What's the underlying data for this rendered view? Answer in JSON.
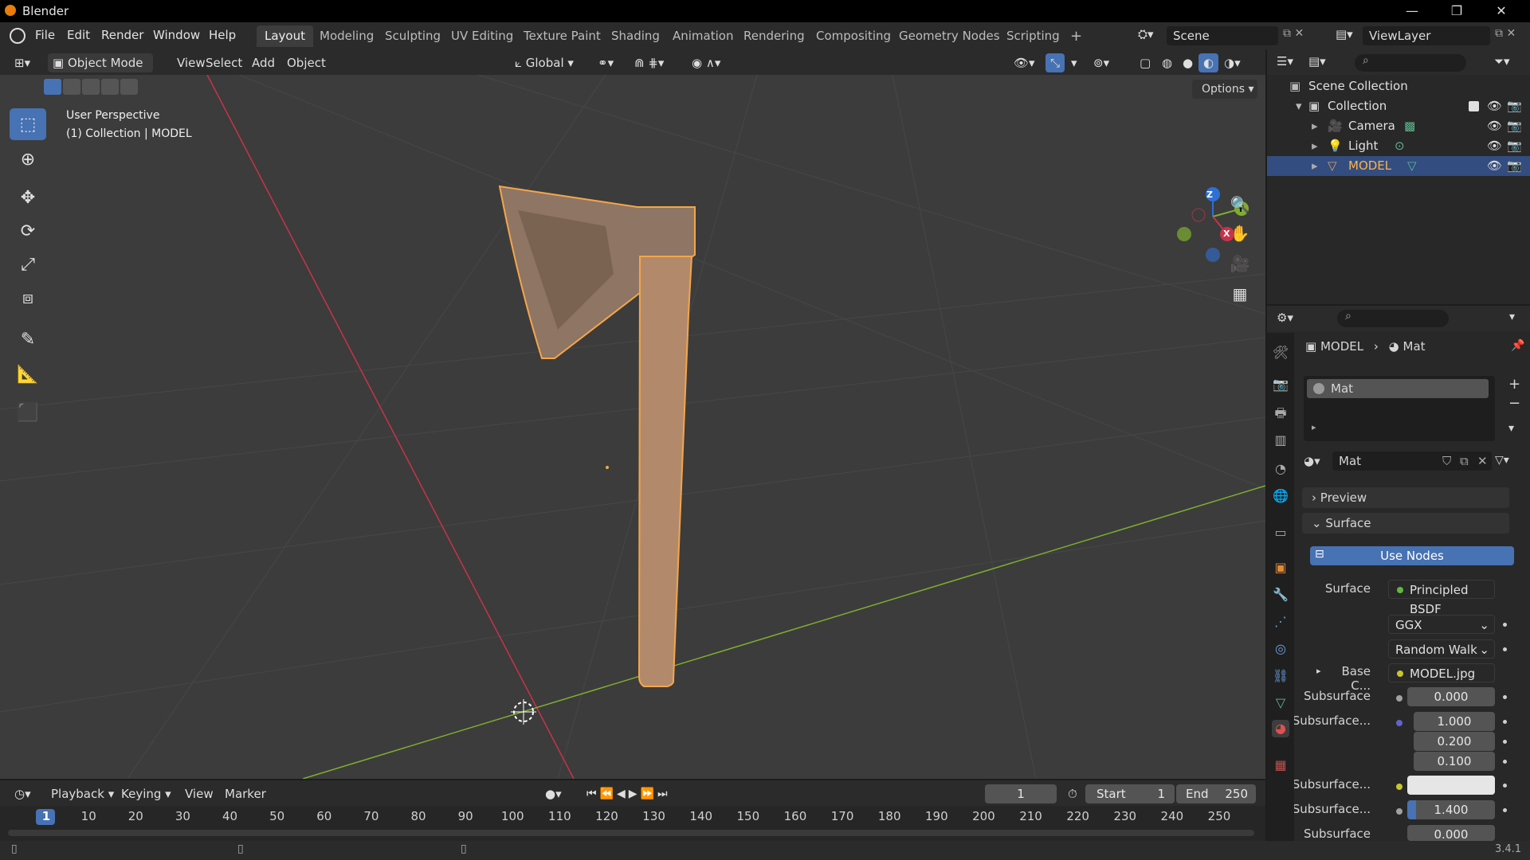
{
  "app": {
    "title": "Blender",
    "version": "3.4.1"
  },
  "window_controls": {
    "minimize": "—",
    "restore": "❐",
    "close": "✕"
  },
  "menu": [
    "File",
    "Edit",
    "Render",
    "Window",
    "Help"
  ],
  "workspaces": [
    "Layout",
    "Modeling",
    "Sculpting",
    "UV Editing",
    "Texture Paint",
    "Shading",
    "Animation",
    "Rendering",
    "Compositing",
    "Geometry Nodes",
    "Scripting"
  ],
  "add_workspace": "+",
  "scene": {
    "label": "Scene",
    "view_layer": "ViewLayer"
  },
  "viewport_header": {
    "mode": "Object Mode",
    "menus": [
      "View",
      "Select",
      "Add",
      "Object"
    ],
    "transform_orientation": "Global",
    "options": "Options"
  },
  "viewport": {
    "perspective": "User Perspective",
    "context": "(1) Collection | MODEL",
    "gizmo": {
      "x": "X",
      "y": "Y",
      "z": "Z"
    },
    "colors": {
      "x_axis": "#c8334a",
      "y_axis": "#7fae2e",
      "z_axis": "#2e6fd4",
      "selection": "#f4a64a",
      "active_tool": "#4772b3"
    }
  },
  "toolbar": [
    "select-box",
    "cursor",
    "move",
    "rotate",
    "scale",
    "transform",
    "annotate",
    "measure",
    "add-cube"
  ],
  "outliner": {
    "root": "Scene Collection",
    "collection": "Collection",
    "objects": [
      {
        "name": "Camera",
        "type": "camera",
        "selected": false
      },
      {
        "name": "Light",
        "type": "light",
        "selected": false
      },
      {
        "name": "MODEL",
        "type": "mesh",
        "selected": true
      }
    ]
  },
  "properties": {
    "breadcrumb": {
      "object": "MODEL",
      "material": "Mat"
    },
    "slot": "Mat",
    "material_name": "Mat",
    "panels": {
      "preview": "Preview",
      "surface": "Surface"
    },
    "use_nodes": "Use Nodes",
    "surface": {
      "label": "Surface",
      "value": "Principled BSDF"
    },
    "distribution": "GGX",
    "subsurface_method": "Random Walk",
    "base_color": {
      "label": "Base C...",
      "value": "MODEL.jpg"
    },
    "subsurface": {
      "label": "Subsurface",
      "value": "0.000"
    },
    "subsurface_radius": {
      "label": "Subsurface...",
      "values": [
        "1.000",
        "0.200",
        "0.100"
      ]
    },
    "subsurface_color": {
      "label": "Subsurface..."
    },
    "subsurface_ior": {
      "label": "Subsurface...",
      "value": "1.400"
    },
    "subsurface_aniso": {
      "label": "Subsurface",
      "value": "0.000"
    }
  },
  "timeline": {
    "menus": [
      "Playback",
      "Keying",
      "View",
      "Marker"
    ],
    "current_frame": "1",
    "start_label": "Start",
    "start": "1",
    "end_label": "End",
    "end": "250",
    "ticks": [
      "1",
      "10",
      "20",
      "30",
      "40",
      "50",
      "60",
      "70",
      "80",
      "90",
      "100",
      "110",
      "120",
      "130",
      "140",
      "150",
      "160",
      "170",
      "180",
      "190",
      "200",
      "210",
      "220",
      "230",
      "240",
      "250"
    ]
  }
}
